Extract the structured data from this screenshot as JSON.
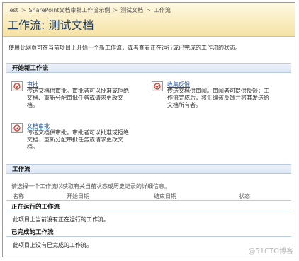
{
  "breadcrumb": {
    "items": [
      "Test",
      "SharePoint文档审批工作流示例",
      "测试文档",
      "工作流"
    ]
  },
  "page_title": "工作流: 测试文档",
  "intro": "使用此网页可在当前项目上开始一个新工作流，或者查看正在运行或已完成的工作流的状态。",
  "start_section": {
    "title": "开始新工作流",
    "workflows": [
      {
        "name": "审批",
        "description": "传送文档供审批。审批者可以批准或拒绝文档、重新分配审批任务或请求更改文档。"
      },
      {
        "name": "收集反馈",
        "description": "传送文档供审阅。审阅者可提供反馈；工作流完成后，将汇编该反馈并将其发送给文档所有者。"
      },
      {
        "name": "文档审批",
        "description": "传送文档供审批。审批者可以批准或拒绝文档、重新分配审批任务或请求更改文档。"
      }
    ]
  },
  "workflow_section": {
    "title": "工作流",
    "hint": "请选择一个工作流以获取有关当前状态或历史记录的详细信息。",
    "columns": [
      "名称",
      "开始日期",
      "结束日期",
      "状态"
    ],
    "running_title": "正在运行的工作流",
    "running_empty": "此项目上当前没有正在运行的工作流。",
    "completed_title": "已完成的工作流",
    "completed_empty": "此项目上没有已完成的工作流。"
  },
  "watermark": "@51CTO博客",
  "icons": {
    "workflow": "approval-check-icon"
  },
  "colors": {
    "title_bar": "#f6e2a4",
    "link": "#1f4f9a",
    "section_bar": "#dbe6f5",
    "title_text": "#1b3d6a"
  }
}
